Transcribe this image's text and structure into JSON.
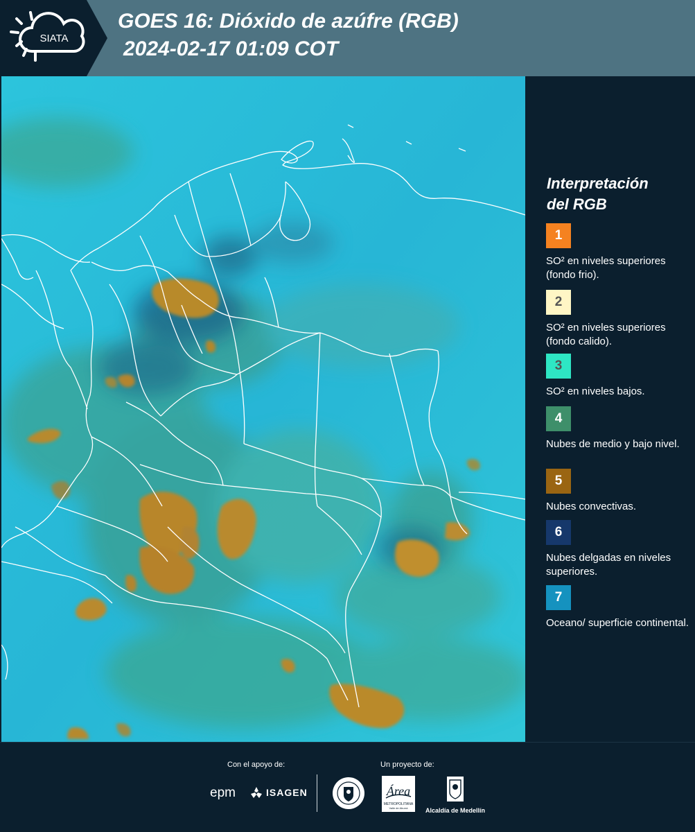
{
  "header": {
    "logo_text": "SIATA",
    "title": "GOES 16: Dióxido de azúfre (RGB)",
    "subtitle": "2024-02-17 01:09 COT"
  },
  "legend": {
    "title_line1": "Interpretación",
    "title_line2": "del RGB",
    "items": [
      {
        "number": "1",
        "color": "#f58220",
        "text_color": "#ffffff",
        "label": "SO² en niveles superiores (fondo frio)."
      },
      {
        "number": "2",
        "color": "#fff6c5",
        "text_color": "#555555",
        "label": "SO² en niveles superiores (fondo calido)."
      },
      {
        "number": "3",
        "color": "#2ee6c4",
        "text_color": "#555555",
        "label": "SO² en niveles bajos."
      },
      {
        "number": "4",
        "color": "#3e8f6a",
        "text_color": "#ffffff",
        "label": "Nubes de medio y bajo nivel."
      },
      {
        "number": "5",
        "color": "#9a6512",
        "text_color": "#ffffff",
        "label": "Nubes convectivas."
      },
      {
        "number": "6",
        "color": "#16386b",
        "text_color": "#ffffff",
        "label": "Nubes delgadas en niveles superiores."
      },
      {
        "number": "7",
        "color": "#1592bf",
        "text_color": "#ffffff",
        "label": "Oceano/ superficie continental."
      }
    ]
  },
  "footer": {
    "support_label": "Con el apoyo de:",
    "project_label": "Un proyecto de:",
    "sponsors": [
      "epm",
      "ISAGEN"
    ],
    "partners": [
      "Área Metropolitana Valle de Aburrá",
      "Alcaldía de Medellín"
    ],
    "area_logo_text": "Área",
    "area_logo_sub": "METROPOLITANA",
    "area_logo_sub2": "Valle de Aburrá",
    "alcaldia_label": "Alcaldía de Medellín"
  }
}
